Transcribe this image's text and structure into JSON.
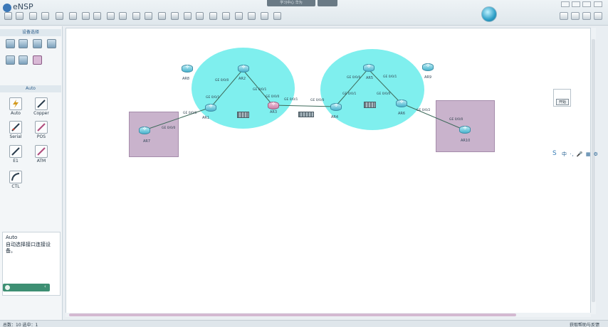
{
  "app": {
    "title": "eNSP"
  },
  "titlebar": {
    "center_tab": "学习中心 华为"
  },
  "left_panel": {
    "device_header": "设备选择",
    "cable_header": "Auto",
    "cables": [
      {
        "name": "Auto",
        "icon": "lightning-icon"
      },
      {
        "name": "Copper",
        "icon": "cable-straight-icon"
      },
      {
        "name": "Serial",
        "icon": "serial-cable-icon"
      },
      {
        "name": "POS",
        "icon": "pos-cable-icon"
      },
      {
        "name": "E1",
        "icon": "e1-cable-icon"
      },
      {
        "name": "ATM",
        "icon": "atm-cable-icon"
      },
      {
        "name": "CTL",
        "icon": "ctl-cable-icon"
      }
    ],
    "description": {
      "title": "Auto",
      "text": "自动选择接口连接设备。"
    }
  },
  "topology": {
    "devices": {
      "ar1": "AR1",
      "ar2": "AR2",
      "ar3": "AR3",
      "ar4": "AR4",
      "ar5": "AR5",
      "ar6": "AR6",
      "ar7": "AR7",
      "ar8": "AR8",
      "ar9": "AR9",
      "ar10": "AR10"
    },
    "ports": {
      "ar7_ar1_a": "GE 0/0/0",
      "ar7_ar1_b": "GE 0/0/0",
      "ar1_ar2_a": "GE 0/0/1",
      "ar1_ar2_b": "GE 0/0/0",
      "ar2_ar3_a": "GE 0/0/1",
      "ar2_ar3_b": "GE 0/0/0",
      "ar3_ar4_a": "GE 0/0/1",
      "ar3_ar4_b": "GE 0/0/0",
      "ar4_ar5_a": "GE 0/0/1",
      "ar4_ar5_b": "GE 0/0/0",
      "ar5_ar6_a": "GE 0/0/1",
      "ar5_ar6_b": "GE 0/0/0",
      "ar6_ar10_a": "GE 0/0/2",
      "ar6_ar10_b": "GE 0/0/0"
    },
    "colors": {
      "area_cyan": "#7fefee",
      "area_purple": "#c9b3cc",
      "link": "#3d6a5a"
    }
  },
  "start_card": {
    "button": "开始"
  },
  "ime": {
    "text": "中 ·, 🎤 ▦ ⚙"
  },
  "status": {
    "left": "总数：10 选中：1",
    "right": "获取帮助与反馈"
  }
}
